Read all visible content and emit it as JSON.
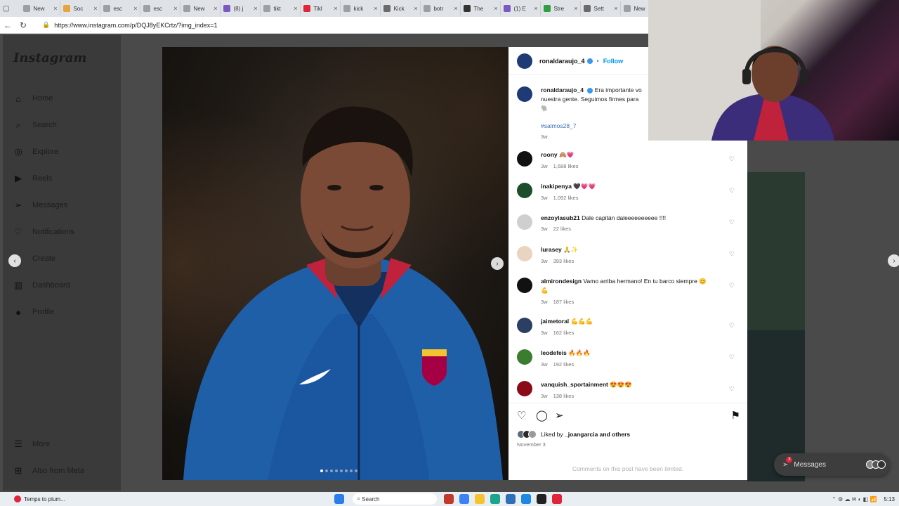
{
  "browser": {
    "tabs": [
      {
        "label": "New",
        "color": "#9aa0a6"
      },
      {
        "label": "Soc",
        "color": "#e8a33a"
      },
      {
        "label": "esc",
        "color": "#9aa0a6"
      },
      {
        "label": "esc",
        "color": "#9aa0a6"
      },
      {
        "label": "New",
        "color": "#9aa0a6"
      },
      {
        "label": "(8) j",
        "color": "#7a58c2"
      },
      {
        "label": "tikt",
        "color": "#9aa0a6"
      },
      {
        "label": "Tikl",
        "color": "#e0243a"
      },
      {
        "label": "kick",
        "color": "#9aa0a6"
      },
      {
        "label": "Kick",
        "color": "#6a6a6a"
      },
      {
        "label": "botr",
        "color": "#9aa0a6"
      },
      {
        "label": "The",
        "color": "#333333"
      },
      {
        "label": "(1) E",
        "color": "#7a58c2"
      },
      {
        "label": "Stre",
        "color": "#2e9e3e"
      },
      {
        "label": "Sett",
        "color": "#6a6a6a"
      },
      {
        "label": "New",
        "color": "#9aa0a6"
      }
    ],
    "url": "https://www.instagram.com/p/DQJ8yEKCrtz/?img_index=1"
  },
  "sidebar": {
    "logo": "Instagram",
    "items": [
      {
        "label": "Home",
        "icon": "⌂"
      },
      {
        "label": "Search",
        "icon": "⌕"
      },
      {
        "label": "Explore",
        "icon": "◎"
      },
      {
        "label": "Reels",
        "icon": "▶"
      },
      {
        "label": "Messages",
        "icon": "➢"
      },
      {
        "label": "Notifications",
        "icon": "♡"
      },
      {
        "label": "Create",
        "icon": "+"
      },
      {
        "label": "Dashboard",
        "icon": "▥"
      },
      {
        "label": "Profile",
        "icon": "●"
      }
    ],
    "messages_badge": "3",
    "more": "More",
    "also_from_meta": "Also from Meta"
  },
  "post": {
    "author": "ronaldaraujo_4",
    "follow_label": "Follow",
    "caption_text": "Era importante vo",
    "caption_line2": "nuestra gente. Seguimos firmes para",
    "caption_emoji": "🐘",
    "hashtag": "#salmos28_7",
    "caption_time": "3w",
    "comments": [
      {
        "user": "roony",
        "text": "🙈💗",
        "time": "3w",
        "likes": "1,688 likes",
        "color": "#111111"
      },
      {
        "user": "inakipenya",
        "text": "🖤💗💗",
        "time": "3w",
        "likes": "1,092 likes",
        "color": "#1d4d2a"
      },
      {
        "user": "enzoylasub21",
        "text": "Dale capitán daleeeeeeeeee !!!!",
        "time": "3w",
        "likes": "22 likes",
        "color": "#cfcfcf"
      },
      {
        "user": "lurasey",
        "text": "🙏✨",
        "time": "3w",
        "likes": "393 likes",
        "color": "#e8d4c0"
      },
      {
        "user": "almirondesign",
        "text": "Vamo arriba hermano! En tu barco siempre 😊",
        "text2": "💪",
        "time": "3w",
        "likes": "187 likes",
        "color": "#111111"
      },
      {
        "user": "jaimetoral",
        "text": "💪💪💪",
        "time": "3w",
        "likes": "162 likes",
        "color": "#2b3e63"
      },
      {
        "user": "leodefeis",
        "text": "🔥🔥🔥",
        "time": "3w",
        "likes": "192 likes",
        "color": "#3a7d2e"
      },
      {
        "user": "vanquish_sportainment",
        "text": "😍😍😍",
        "time": "3w",
        "likes": "138 likes",
        "color": "#8b0a1a"
      }
    ],
    "liked_by_prefix": "Liked by",
    "liked_by_user": "_joangarcia",
    "liked_by_suffix": "and others",
    "date": "November 3",
    "comments_limited": "Comments on this post have been limited."
  },
  "messages_pill": {
    "label": "Messages",
    "badge": "3"
  },
  "taskbar": {
    "notification": "Temps to plum...",
    "search_placeholder": "Search",
    "clock": "5:13"
  }
}
